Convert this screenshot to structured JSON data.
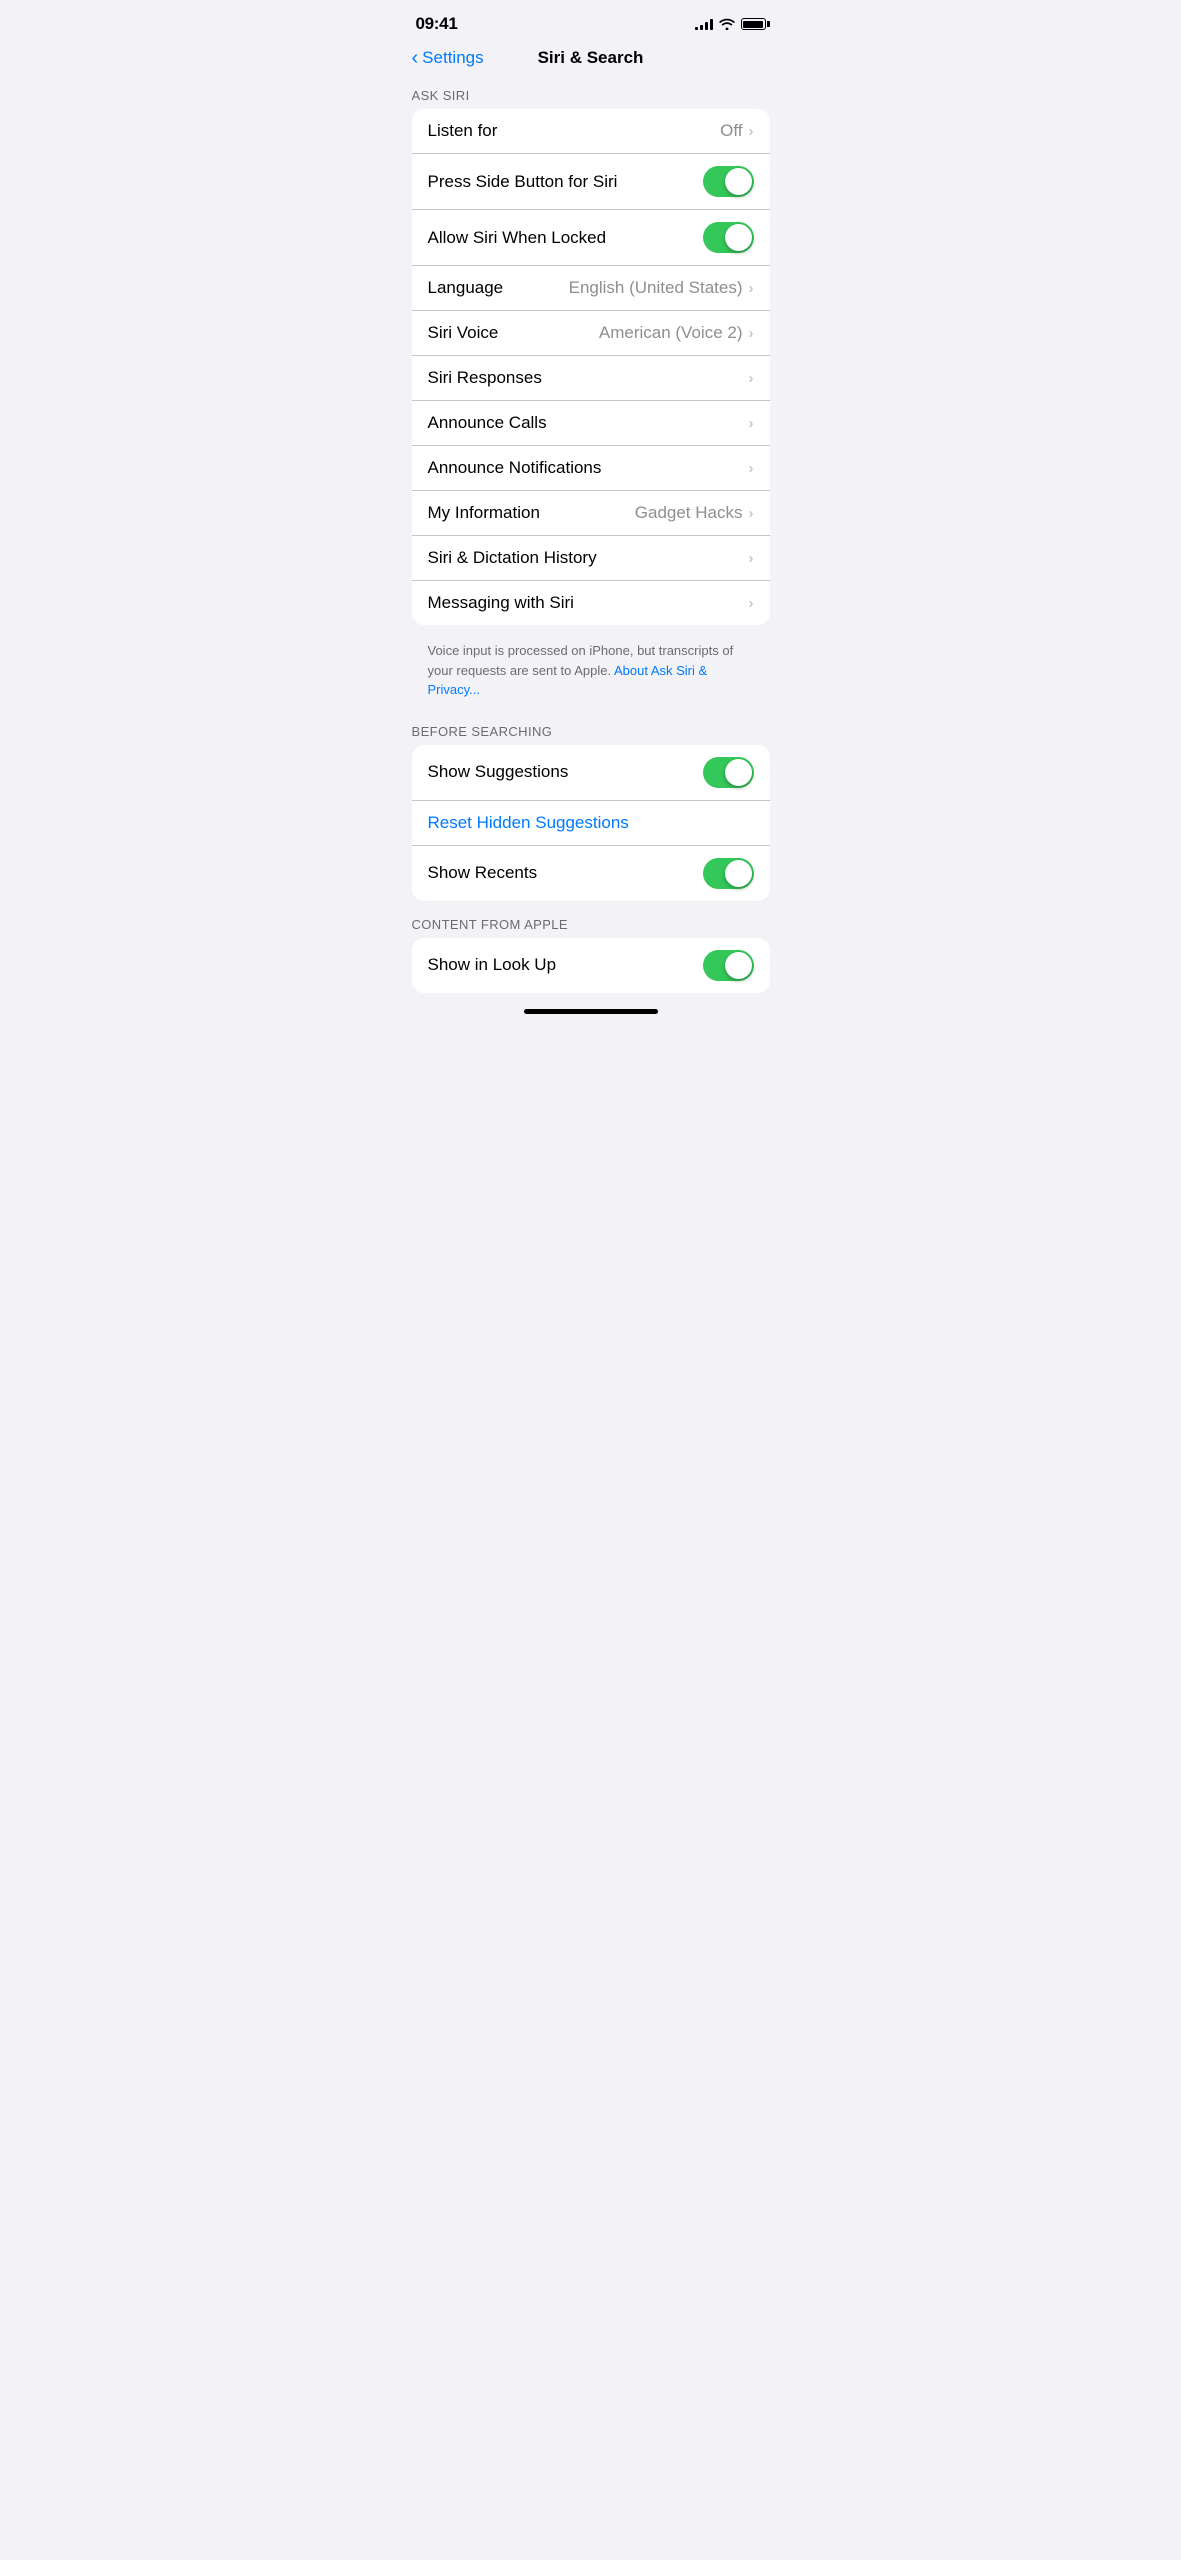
{
  "status_bar": {
    "time": "09:41",
    "signal_bars": [
      3,
      6,
      9,
      11,
      12
    ],
    "wifi": "wifi",
    "battery": "battery"
  },
  "nav": {
    "back_label": "Settings",
    "title": "Siri & Search"
  },
  "sections": [
    {
      "id": "ask-siri",
      "label": "ASK SIRI",
      "rows": [
        {
          "id": "listen-for",
          "label": "Listen for",
          "value": "Off",
          "type": "nav"
        },
        {
          "id": "press-side-button",
          "label": "Press Side Button for Siri",
          "value": null,
          "type": "toggle",
          "on": true
        },
        {
          "id": "allow-when-locked",
          "label": "Allow Siri When Locked",
          "value": null,
          "type": "toggle",
          "on": true
        },
        {
          "id": "language",
          "label": "Language",
          "value": "English (United States)",
          "type": "nav"
        },
        {
          "id": "siri-voice",
          "label": "Siri Voice",
          "value": "American (Voice 2)",
          "type": "nav"
        },
        {
          "id": "siri-responses",
          "label": "Siri Responses",
          "value": null,
          "type": "nav"
        },
        {
          "id": "announce-calls",
          "label": "Announce Calls",
          "value": null,
          "type": "nav"
        },
        {
          "id": "announce-notifications",
          "label": "Announce Notifications",
          "value": null,
          "type": "nav"
        },
        {
          "id": "my-information",
          "label": "My Information",
          "value": "Gadget Hacks",
          "type": "nav"
        },
        {
          "id": "siri-dictation-history",
          "label": "Siri & Dictation History",
          "value": null,
          "type": "nav"
        },
        {
          "id": "messaging-with-siri",
          "label": "Messaging with Siri",
          "value": null,
          "type": "nav"
        }
      ],
      "footer": {
        "text": "Voice input is processed on iPhone, but transcripts of your requests are sent to Apple.",
        "link_text": "About Ask Siri & Privacy...",
        "link_href": "#"
      }
    },
    {
      "id": "before-searching",
      "label": "BEFORE SEARCHING",
      "rows": [
        {
          "id": "show-suggestions",
          "label": "Show Suggestions",
          "value": null,
          "type": "toggle",
          "on": true
        },
        {
          "id": "reset-hidden-suggestions",
          "label": "Reset Hidden Suggestions",
          "value": null,
          "type": "link"
        },
        {
          "id": "show-recents",
          "label": "Show Recents",
          "value": null,
          "type": "toggle",
          "on": true
        }
      ]
    },
    {
      "id": "content-from-apple",
      "label": "CONTENT FROM APPLE",
      "rows": [
        {
          "id": "show-in-look-up",
          "label": "Show in Look Up",
          "value": null,
          "type": "toggle",
          "on": true
        }
      ]
    }
  ]
}
